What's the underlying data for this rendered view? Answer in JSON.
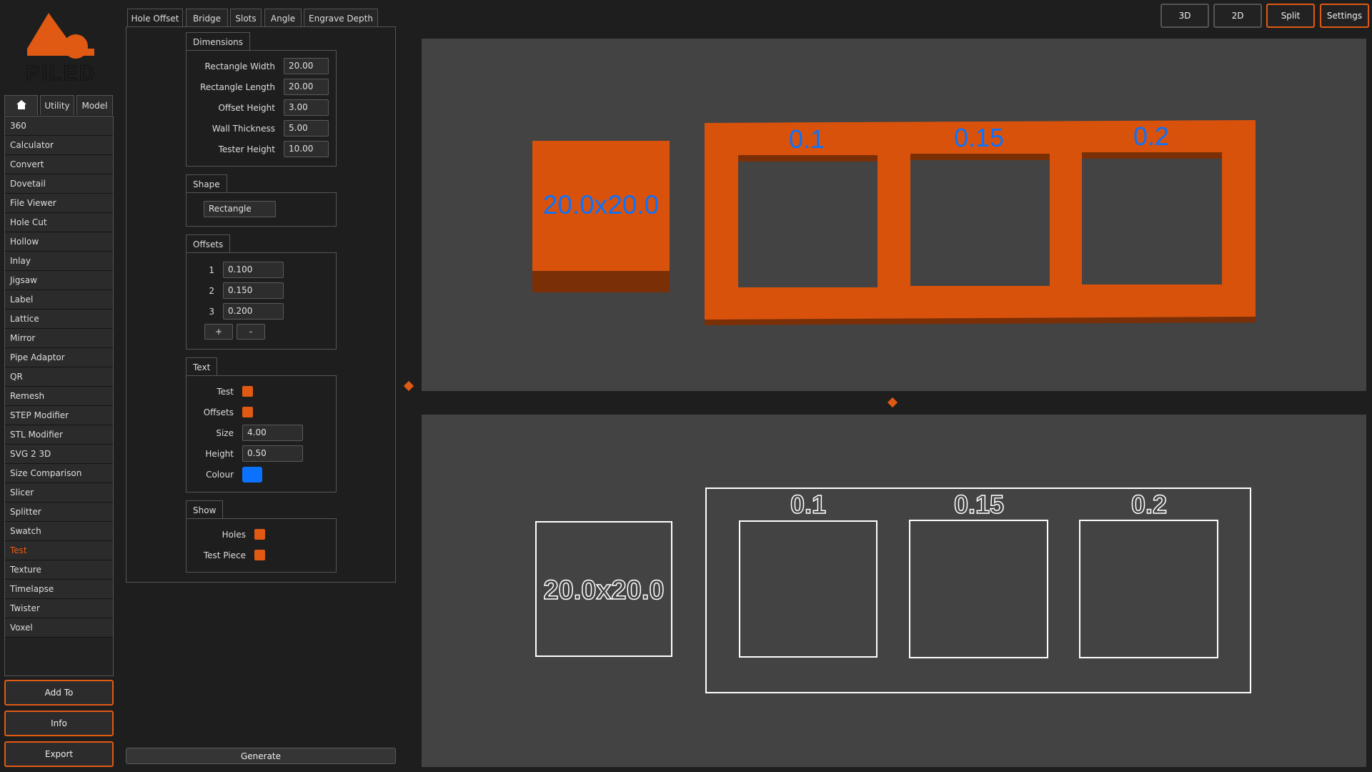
{
  "app": {
    "logo_text": "PILED"
  },
  "left_tabs": {
    "home_icon": "home-icon",
    "utility": "Utility",
    "model": "Model"
  },
  "tools": [
    "360",
    "Calculator",
    "Convert",
    "Dovetail",
    "File Viewer",
    "Hole Cut",
    "Hollow",
    "Inlay",
    "Jigsaw",
    "Label",
    "Lattice",
    "Mirror",
    "Pipe Adaptor",
    "QR",
    "Remesh",
    "STEP Modifier",
    "STL Modifier",
    "SVG 2 3D",
    "Size Comparison",
    "Slicer",
    "Splitter",
    "Swatch",
    "Test",
    "Texture",
    "Timelapse",
    "Twister",
    "Voxel"
  ],
  "active_tool": "Test",
  "bottom_buttons": {
    "add_to": "Add To",
    "info": "Info",
    "export": "Export"
  },
  "tool_tabs": [
    "Hole Offset",
    "Bridge",
    "Slots",
    "Angle",
    "Engrave Depth"
  ],
  "active_tool_tab": "Hole Offset",
  "dimensions": {
    "title": "Dimensions",
    "fields": [
      {
        "label": "Rectangle Width",
        "value": "20.00"
      },
      {
        "label": "Rectangle Length",
        "value": "20.00"
      },
      {
        "label": "Offset Height",
        "value": "3.00"
      },
      {
        "label": "Wall Thickness",
        "value": "5.00"
      },
      {
        "label": "Tester Height",
        "value": "10.00"
      }
    ]
  },
  "shape": {
    "title": "Shape",
    "value": "Rectangle"
  },
  "offsets": {
    "title": "Offsets",
    "rows": [
      {
        "index": "1",
        "value": "0.100"
      },
      {
        "index": "2",
        "value": "0.150"
      },
      {
        "index": "3",
        "value": "0.200"
      }
    ],
    "add_label": "+",
    "remove_label": "-"
  },
  "text_group": {
    "title": "Text",
    "test_label": "Test",
    "test_checked": true,
    "offsets_label": "Offsets",
    "offsets_checked": true,
    "size_label": "Size",
    "size_value": "4.00",
    "height_label": "Height",
    "height_value": "0.50",
    "colour_label": "Colour",
    "colour_value": "#0a72ff"
  },
  "show_group": {
    "title": "Show",
    "holes_label": "Holes",
    "holes_checked": true,
    "test_piece_label": "Test Piece",
    "test_piece_checked": true
  },
  "generate_label": "Generate",
  "view_buttons": {
    "v3d": "3D",
    "v2d": "2D",
    "split": "Split",
    "settings": "Settings"
  },
  "active_views": [
    "Split",
    "Settings"
  ],
  "preview": {
    "test_piece_label": "20.0x20.0",
    "offset_labels": [
      "0.1",
      "0.15",
      "0.2"
    ]
  },
  "colors": {
    "accent": "#e05a14",
    "model_orange": "#d9520b",
    "text_blue": "#0a72ff",
    "viewport_bg": "#434343"
  }
}
